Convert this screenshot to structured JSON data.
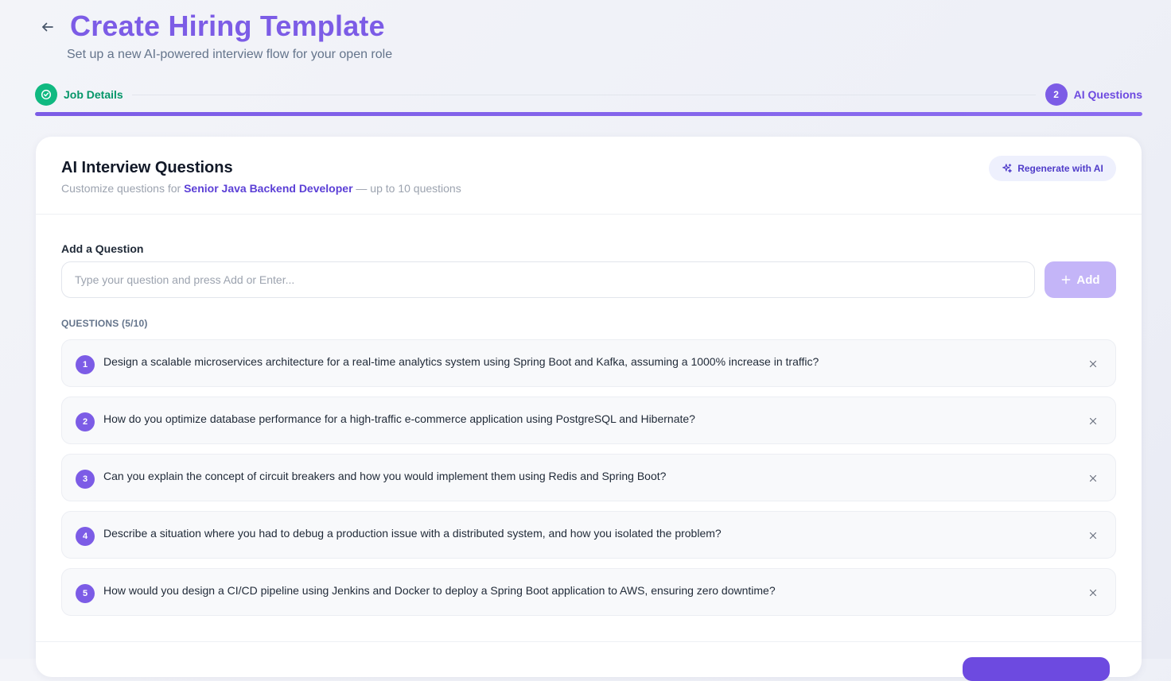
{
  "header": {
    "title": "Create Hiring Template",
    "subtitle": "Set up a new AI-powered interview flow for your open role",
    "back_icon": "arrow-left-icon"
  },
  "stepper": {
    "steps": [
      {
        "label": "Job Details",
        "status": "completed",
        "icon": "check-circle-icon"
      },
      {
        "label": "AI Questions",
        "number": "2",
        "status": "active"
      }
    ],
    "progress_percent": 100
  },
  "card": {
    "title": "AI Interview Questions",
    "subtitle_prefix": "Customize questions for",
    "role": "Senior Java Backend Developer",
    "subtitle_suffix": "— up to 10 questions",
    "regenerate_label": "Regenerate with AI",
    "regenerate_icon": "sparkles-icon"
  },
  "add_question": {
    "label": "Add a Question",
    "placeholder": "Type your question and press Add or Enter...",
    "value": "",
    "button_label": "Add",
    "button_icon": "plus-icon"
  },
  "questions": {
    "header": "QUESTIONS (5/10)",
    "items": [
      {
        "number": "1",
        "text": "Design a scalable microservices architecture for a real-time analytics system using Spring Boot and Kafka, assuming a 1000% increase in traffic?"
      },
      {
        "number": "2",
        "text": "How do you optimize database performance for a high-traffic e-commerce application using PostgreSQL and Hibernate?"
      },
      {
        "number": "3",
        "text": "Can you explain the concept of circuit breakers and how you would implement them using Redis and Spring Boot?"
      },
      {
        "number": "4",
        "text": "Describe a situation where you had to debug a production issue with a distributed system, and how you isolated the problem?"
      },
      {
        "number": "5",
        "text": "How would you design a CI/CD pipeline using Jenkins and Docker to deploy a Spring Boot application to AWS, ensuring zero downtime?"
      }
    ],
    "remove_icon": "close-icon"
  },
  "colors": {
    "accent": "#7c5ce6",
    "success": "#10b981",
    "add_button_disabled": "#c4b5f8"
  }
}
